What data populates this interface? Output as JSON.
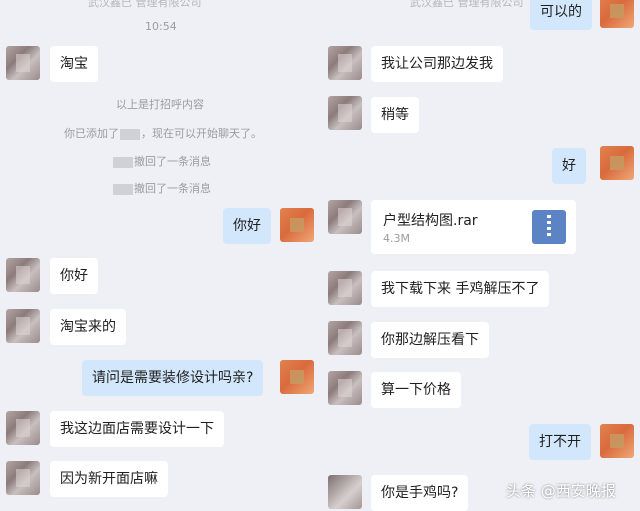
{
  "left_chat": {
    "header_text": "武汉鑫巳 管理有限公司",
    "timestamp": "10:54",
    "messages": [
      {
        "dir": "in",
        "text": "淘宝"
      },
      {
        "dir": "in",
        "text": "你好"
      },
      {
        "dir": "in",
        "text": "淘宝来的"
      },
      {
        "dir": "in",
        "text": "我这边面店需要设计一下"
      },
      {
        "dir": "in",
        "text": "因为新开面店嘛"
      }
    ],
    "sys1": "以上是打招呼内容",
    "sys2_a": "你已添加了",
    "sys2_b": "，现在可以开始聊天了。",
    "recall": "撤回了一条消息",
    "out_messages": [
      {
        "dir": "out",
        "text": "你好"
      },
      {
        "dir": "out",
        "text": "请问是需要装修设计吗亲?"
      }
    ]
  },
  "right_chat": {
    "header_text": "武汉鑫巳 管理有限公司",
    "messages": [
      {
        "dir": "out",
        "text": "可以的"
      },
      {
        "dir": "in",
        "text": "我让公司那边发我"
      },
      {
        "dir": "in",
        "text": "稍等"
      },
      {
        "dir": "out",
        "text": "好"
      },
      {
        "dir": "in",
        "text": "我下载下来 手鸡解压不了"
      },
      {
        "dir": "in",
        "text": "你那边解压看下"
      },
      {
        "dir": "in",
        "text": "算一下价格"
      },
      {
        "dir": "out",
        "text": "打不开"
      },
      {
        "dir": "in",
        "text": "你是手鸡吗?"
      }
    ],
    "file": {
      "name": "户型结构图.rar",
      "size": "4.3M",
      "icon": "archive-icon"
    }
  },
  "watermark": "头条 @西安晚报",
  "colors": {
    "background": "#eef0f5",
    "bubble_in": "#ffffff",
    "bubble_out": "#d2e7fb",
    "file_icon": "#5c84c4"
  }
}
